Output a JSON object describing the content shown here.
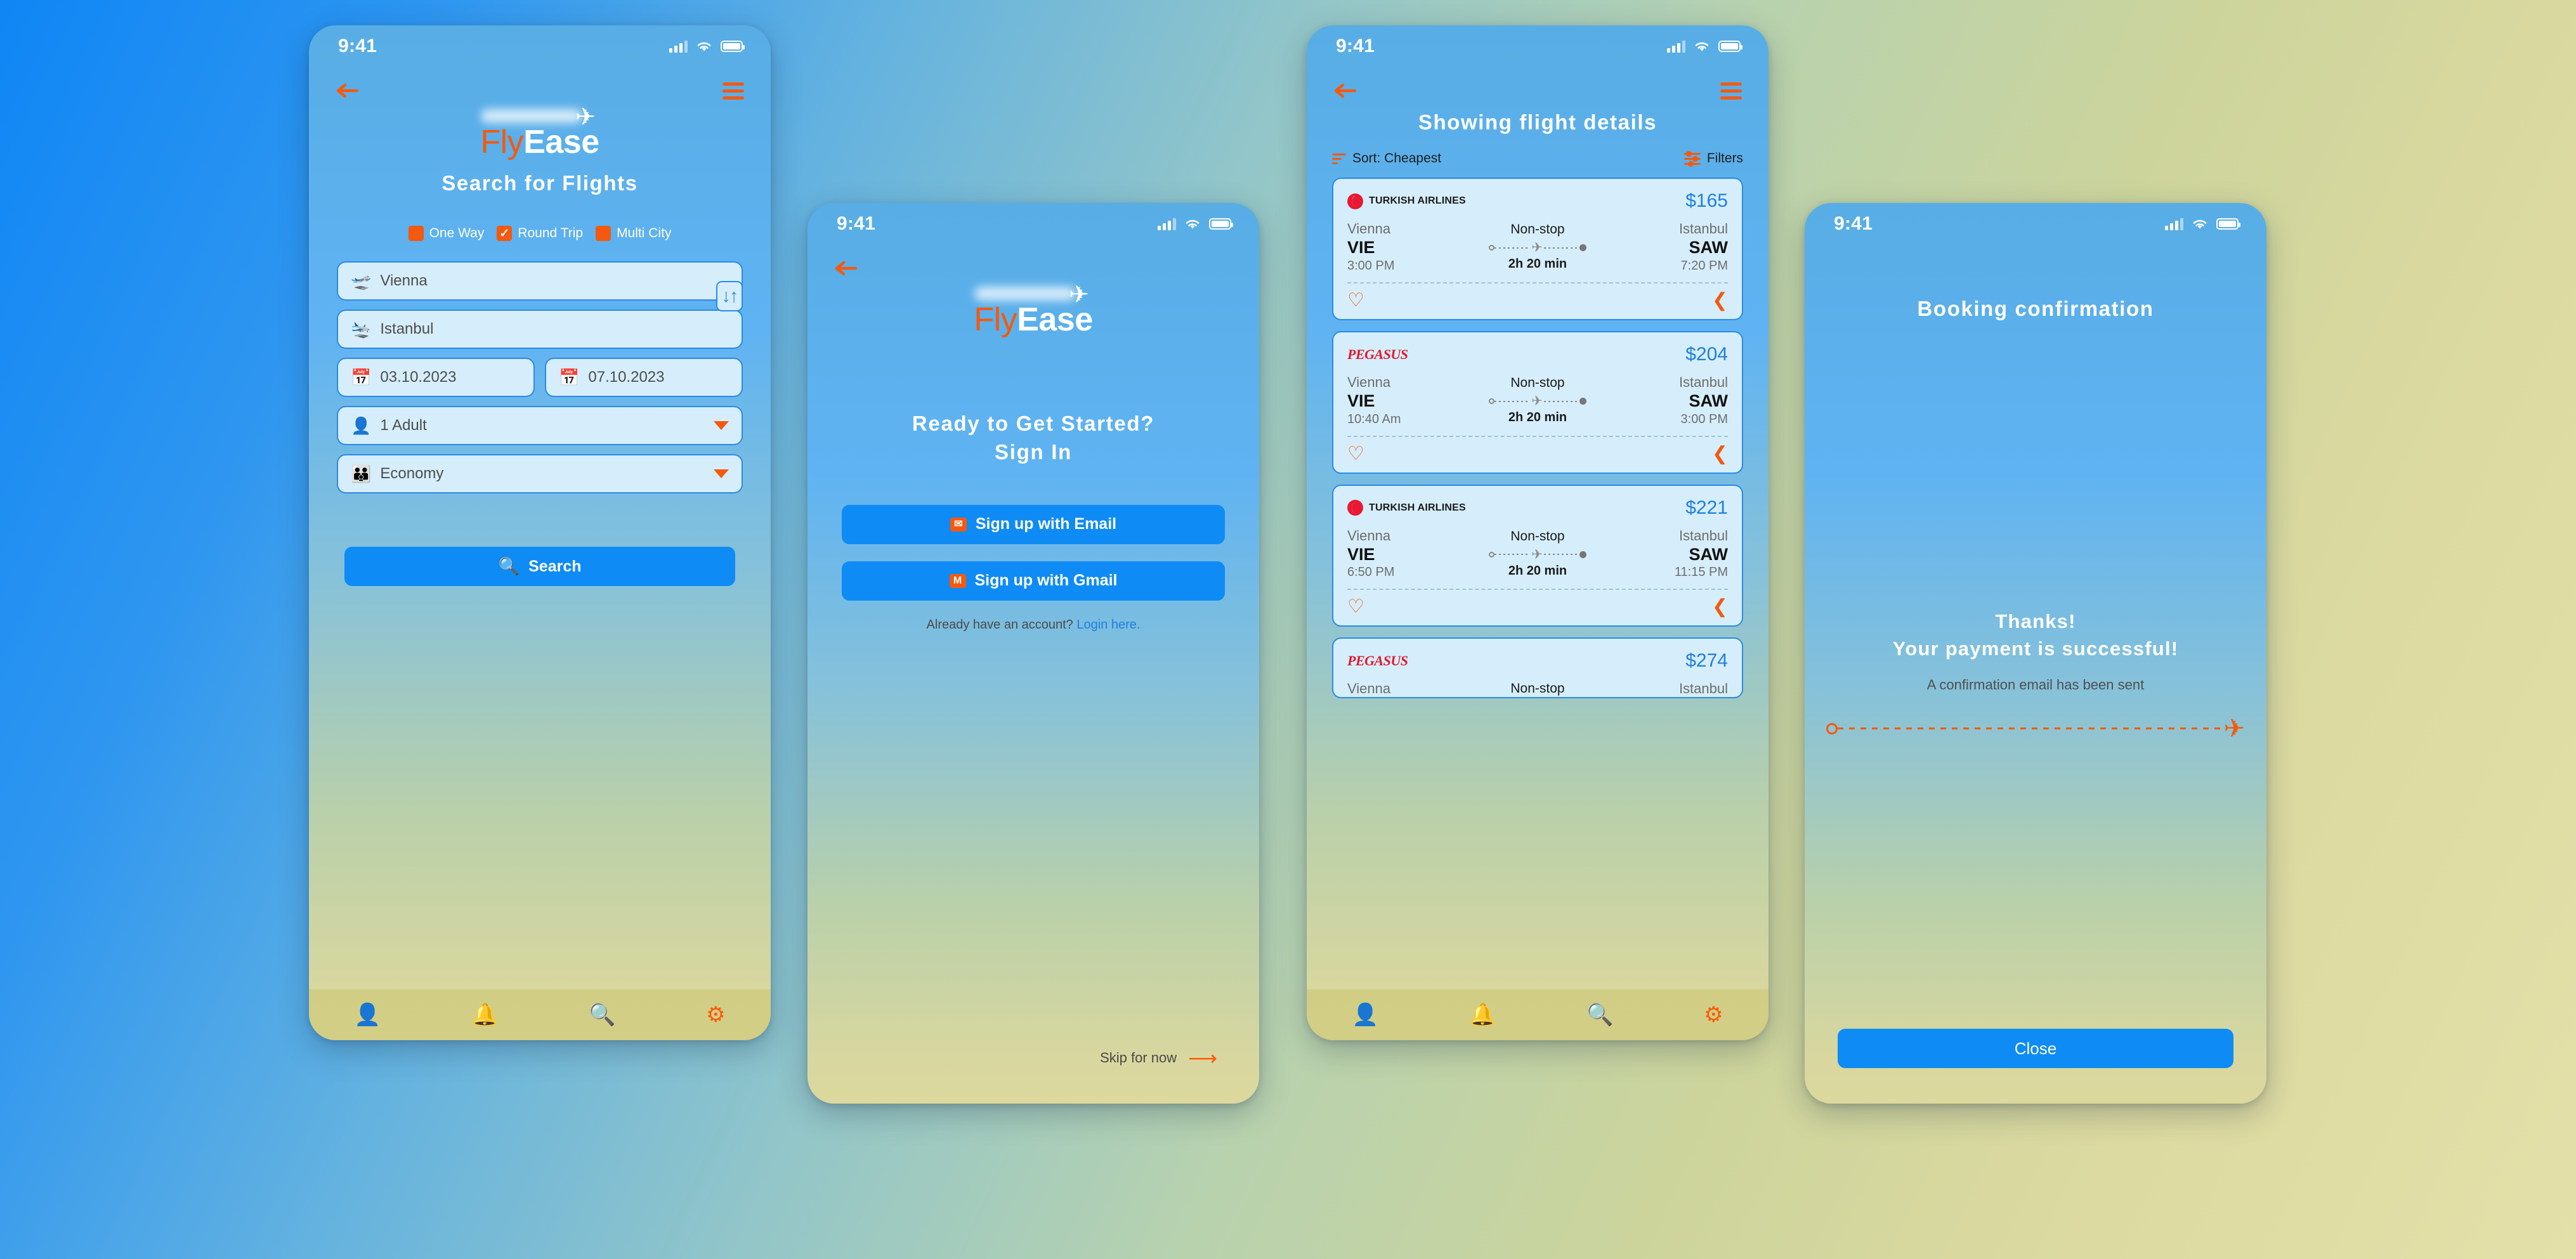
{
  "brand": {
    "name_part1": "Fly",
    "name_part2": "Ease",
    "accent_orange": "#f4590f",
    "accent_blue": "#0e8bf5",
    "price_blue": "#1e7fe0"
  },
  "status_bar": {
    "time": "9:41"
  },
  "search_screen": {
    "title": "Search for Flights",
    "trip_types": [
      {
        "label": "One Way",
        "checked": false
      },
      {
        "label": "Round Trip",
        "checked": true
      },
      {
        "label": "Multi City",
        "checked": false
      }
    ],
    "origin": {
      "value": "Vienna",
      "icon": "plane-departure-icon"
    },
    "destination": {
      "value": "Istanbul",
      "icon": "plane-arrival-icon"
    },
    "depart_date": {
      "value": "03.10.2023",
      "icon": "calendar-icon"
    },
    "return_date": {
      "value": "07.10.2023",
      "icon": "calendar-icon"
    },
    "passengers": {
      "value": "1 Adult",
      "icon": "person-icon"
    },
    "cabin_class": {
      "value": "Economy",
      "icon": "seat-icon"
    },
    "swap_icon": "swap-vertical-icon",
    "search_button": "Search"
  },
  "signin_screen": {
    "heading_line1": "Ready to Get Started?",
    "heading_line2": "Sign In",
    "signup_email": "Sign up with Email",
    "signup_gmail": "Sign up with Gmail",
    "already_text": "Already have an account?",
    "login_link": "Login here.",
    "skip": "Skip for now"
  },
  "flights_screen": {
    "title": "Showing flight details",
    "sort_label": "Sort: Cheapest",
    "filters_label": "Filters",
    "flights": [
      {
        "airline": "TURKISH AIRLINES",
        "airline_style": "turkish",
        "price": "$165",
        "from_city": "Vienna",
        "from_code": "VIE",
        "from_time": "3:00 PM",
        "stops": "Non-stop",
        "duration": "2h 20 min",
        "to_city": "Istanbul",
        "to_code": "SAW",
        "to_time": "7:20 PM"
      },
      {
        "airline": "PEGASUS",
        "airline_style": "pegasus",
        "price": "$204",
        "from_city": "Vienna",
        "from_code": "VIE",
        "from_time": "10:40 Am",
        "stops": "Non-stop",
        "duration": "2h 20 min",
        "to_city": "Istanbul",
        "to_code": "SAW",
        "to_time": "3:00 PM"
      },
      {
        "airline": "TURKISH AIRLINES",
        "airline_style": "turkish",
        "price": "$221",
        "from_city": "Vienna",
        "from_code": "VIE",
        "from_time": "6:50 PM",
        "stops": "Non-stop",
        "duration": "2h 20 min",
        "to_city": "Istanbul",
        "to_code": "SAW",
        "to_time": "11:15 PM"
      },
      {
        "airline": "PEGASUS",
        "airline_style": "pegasus",
        "price": "$274",
        "from_city": "Vienna",
        "from_code": "VIE",
        "from_time": "",
        "stops": "Non-stop",
        "duration": "",
        "to_city": "Istanbul",
        "to_code": "",
        "to_time": ""
      }
    ]
  },
  "booking_screen": {
    "title": "Booking confirmation",
    "thanks_line1": "Thanks!",
    "thanks_line2": "Your payment is successful!",
    "subtext": "A confirmation email has been sent",
    "close_button": "Close"
  },
  "tabbar": [
    {
      "name": "profile",
      "glyph": "●"
    },
    {
      "name": "notifications",
      "glyph": "●"
    },
    {
      "name": "search",
      "glyph": "●"
    },
    {
      "name": "settings",
      "glyph": "●"
    }
  ]
}
